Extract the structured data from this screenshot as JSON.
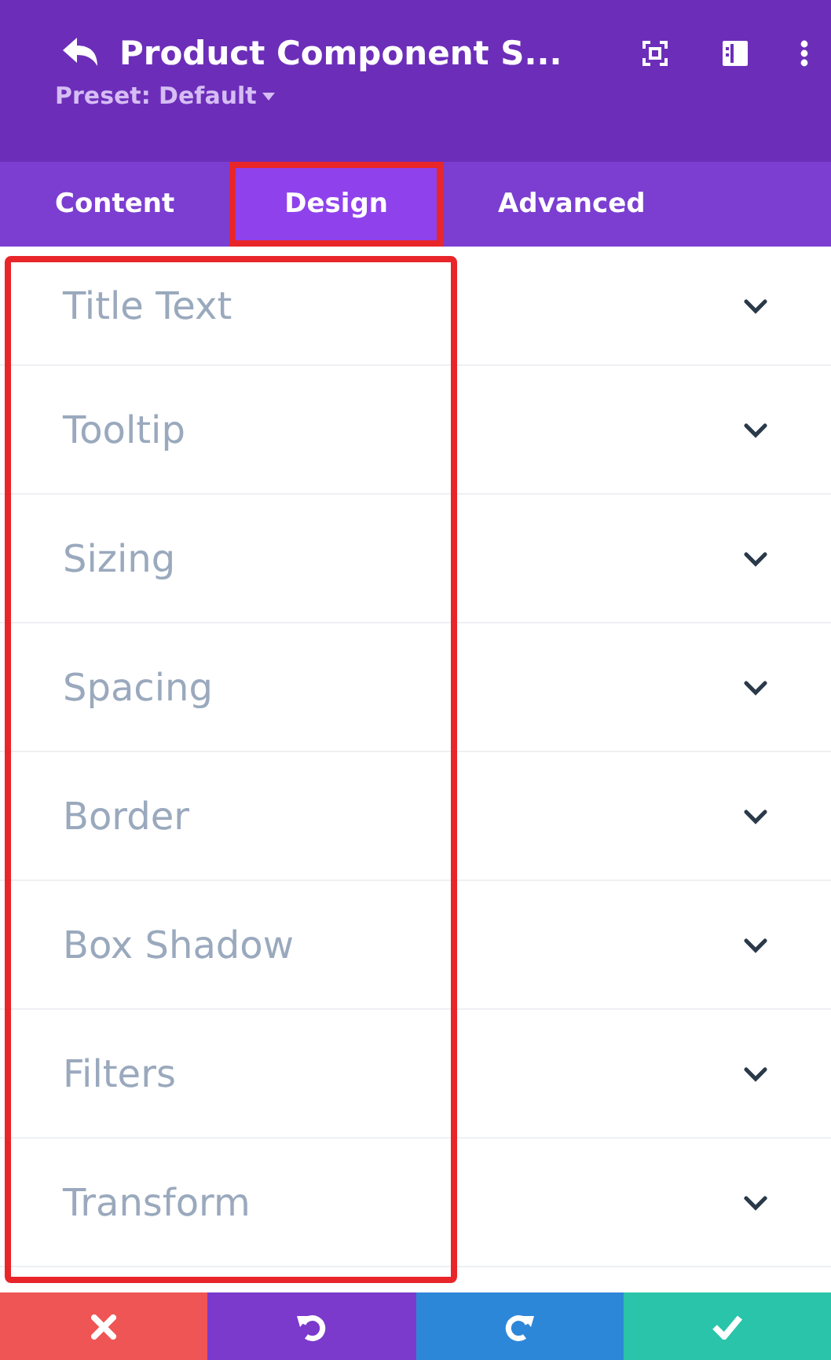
{
  "header": {
    "title": "Product Component S...",
    "preset": "Preset: Default"
  },
  "tabs": [
    {
      "label": "Content",
      "selected": false
    },
    {
      "label": "Design",
      "selected": true,
      "highlighted": true
    },
    {
      "label": "Advanced",
      "selected": false
    }
  ],
  "sections": [
    {
      "label": "Title Text",
      "expanded": false
    },
    {
      "label": "Tooltip",
      "expanded": false
    },
    {
      "label": "Sizing",
      "expanded": false
    },
    {
      "label": "Spacing",
      "expanded": false
    },
    {
      "label": "Border",
      "expanded": false
    },
    {
      "label": "Box Shadow",
      "expanded": false
    },
    {
      "label": "Filters",
      "expanded": false
    },
    {
      "label": "Transform",
      "expanded": false
    }
  ],
  "footer_buttons": [
    {
      "kind": "cancel"
    },
    {
      "kind": "undo"
    },
    {
      "kind": "redo"
    },
    {
      "kind": "save"
    }
  ]
}
